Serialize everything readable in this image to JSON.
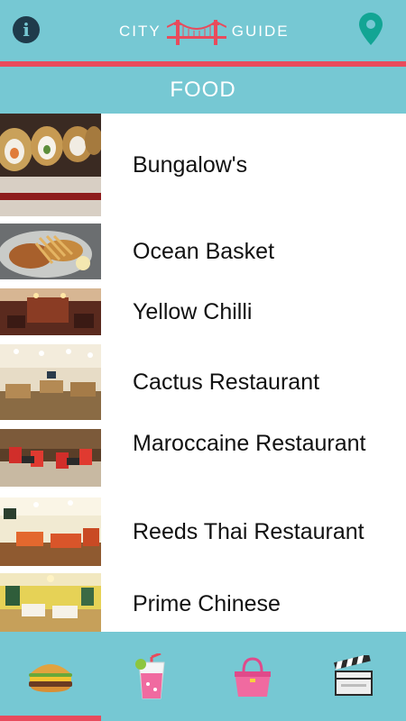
{
  "header": {
    "logo_left": "CITY",
    "logo_right": "GUIDE",
    "info_icon": "info-icon",
    "location_icon": "map-pin-icon"
  },
  "section": {
    "title": "FOOD"
  },
  "restaurants": [
    {
      "name": "Bungalow's",
      "thumb": "sushi-photo"
    },
    {
      "name": "Ocean Basket",
      "thumb": "seafood-platter-photo"
    },
    {
      "name": "Yellow Chilli",
      "thumb": "restaurant-interior-photo"
    },
    {
      "name": "Cactus Restaurant",
      "thumb": "dining-hall-photo"
    },
    {
      "name": "Maroccaine Restaurant",
      "thumb": "red-chairs-interior-photo"
    },
    {
      "name": "Reeds Thai Restaurant",
      "thumb": "thai-dining-room-photo"
    },
    {
      "name": "Prime Chinese",
      "thumb": "chinese-dining-room-photo"
    }
  ],
  "bottom_nav": [
    {
      "icon": "burger-icon",
      "category": "food",
      "active": true
    },
    {
      "icon": "drink-icon",
      "category": "drinks",
      "active": false
    },
    {
      "icon": "handbag-icon",
      "category": "shopping",
      "active": false
    },
    {
      "icon": "clapperboard-icon",
      "category": "entertainment",
      "active": false
    }
  ],
  "colors": {
    "primary": "#76c8d3",
    "accent": "#e84b5c",
    "text": "#111111"
  }
}
